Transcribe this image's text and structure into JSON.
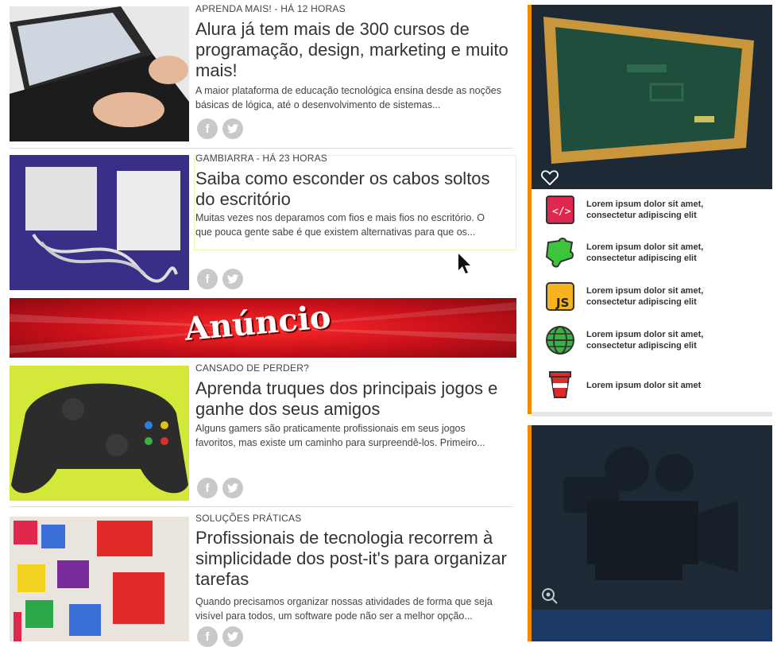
{
  "articles": [
    {
      "meta": "APRENDA MAIS! - HÁ 12 HORAS",
      "title": "Alura já tem mais de 300 cursos de programação, design, marketing e muito mais!",
      "excerpt": "A maior plataforma de educação tecnológica ensina desde as noções básicas de lógica, até o desenvolvimento de sistemas..."
    },
    {
      "meta": "GAMBIARRA - HÁ 23 HORAS",
      "title": "Saiba como esconder os cabos soltos do escritório",
      "excerpt": "Muitas vezes nos deparamos com fios e mais fios no escritório. O que pouca gente sabe é que existem alternativas para que os..."
    },
    {
      "meta": "CANSADO DE PERDER?",
      "title": "Aprenda truques dos principais jogos e ganhe dos seus amigos",
      "excerpt": "Alguns gamers são praticamente profissionais em seus jogos favoritos, mas existe um caminho para surpreendê-los. Primeiro..."
    },
    {
      "meta": "SOLUÇÕES PRÁTICAS",
      "title": "Profissionais de tecnologia recorrem à simplicidade dos post-it's para organizar tarefas",
      "excerpt": "Quando precisamos organizar nossas atividades de forma que seja visível para todos, um software pode não ser a melhor opção..."
    }
  ],
  "ad": {
    "label": "Anúncio"
  },
  "sidebar": {
    "items": [
      {
        "icon": "html-code-icon",
        "text": "Lorem ipsum dolor sit amet, consectetur adipiscing elit"
      },
      {
        "icon": "puzzle-icon",
        "text": "Lorem ipsum dolor sit amet, consectetur adipiscing elit"
      },
      {
        "icon": "js-icon",
        "text": "Lorem ipsum dolor sit amet, consectetur adipiscing elit"
      },
      {
        "icon": "globe-icon",
        "text": "Lorem ipsum dolor sit amet, consectetur adipiscing elit"
      },
      {
        "icon": "coffee-cup-icon",
        "text": "Lorem ipsum dolor sit amet"
      }
    ]
  },
  "colors": {
    "accent": "#f08a00",
    "ad_red": "#c8101a",
    "card_dark": "#1d2a36",
    "board_green": "#1f4f3c"
  }
}
